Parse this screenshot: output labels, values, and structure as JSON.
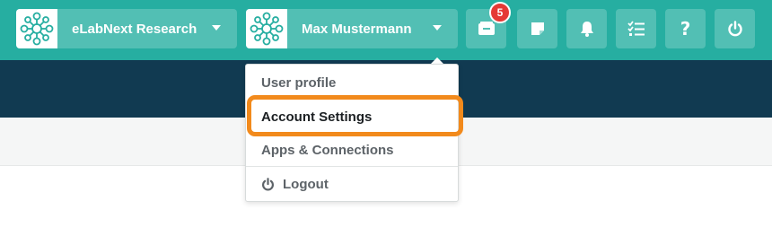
{
  "header": {
    "org_selector": {
      "label": "eLabNext Research",
      "icon": "molecule-logo-icon"
    },
    "user_selector": {
      "label": "Max Mustermann",
      "icon": "molecule-logo-icon"
    },
    "notification_count": "5",
    "icons": [
      "inbox-icon",
      "sticky-note-icon",
      "bell-icon",
      "task-list-icon",
      "help-icon",
      "power-icon"
    ],
    "colors": {
      "topbar": "#26aea1",
      "button": "#52bfb4",
      "navband": "#113a51",
      "badge": "#e53935",
      "highlight": "#f28a1c"
    }
  },
  "user_menu": {
    "items": [
      {
        "label": "User profile"
      },
      {
        "label": "Account Settings",
        "highlighted": true
      },
      {
        "label": "Apps & Connections"
      },
      {
        "label": "Logout",
        "icon": "power-icon"
      }
    ]
  }
}
